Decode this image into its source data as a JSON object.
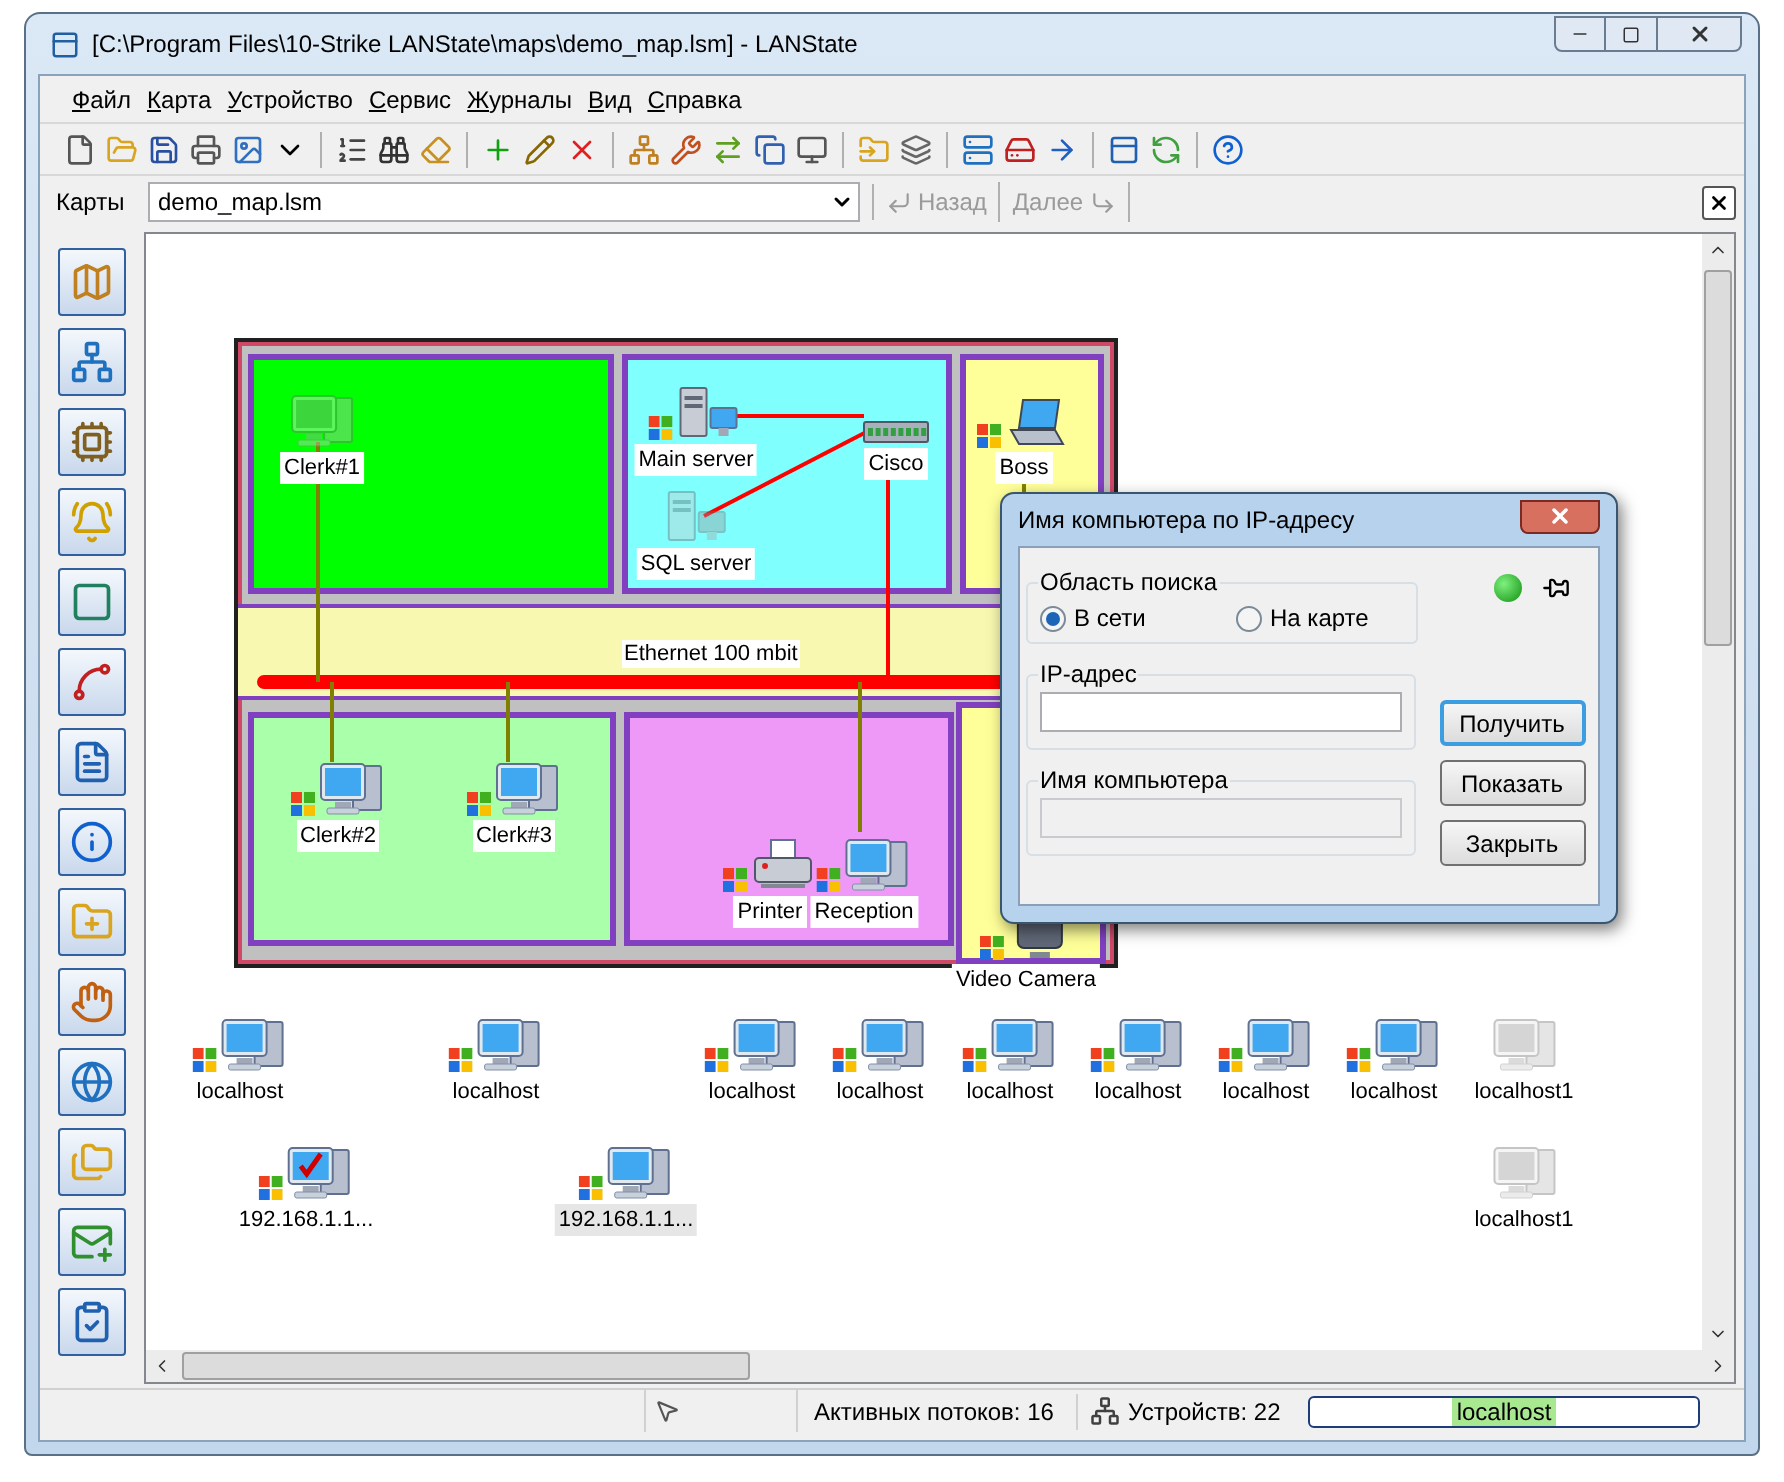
{
  "window": {
    "title": "[C:\\Program Files\\10-Strike LANState\\maps\\demo_map.lsm] - LANState"
  },
  "menu": [
    "Файл",
    "Карта",
    "Устройство",
    "Сервис",
    "Журналы",
    "Вид",
    "Справка"
  ],
  "map_bar": {
    "label": "Карты",
    "value": "demo_map.lsm",
    "back": {
      "label": "Назад",
      "disabled": true
    },
    "forward": {
      "label": "Далее",
      "disabled": true
    }
  },
  "map": {
    "rooms": [
      {
        "color": "#00ff00"
      },
      {
        "color": "#80ffff"
      },
      {
        "color": "#ffff99"
      },
      {
        "color": "#aaffaa"
      },
      {
        "color": "#ee99f8"
      },
      {
        "color": "#ffff99"
      }
    ],
    "segment": {
      "label": "Ethernet 100 mbit"
    },
    "devices": [
      {
        "name": "Clerk#1",
        "kind": "computer",
        "flag": false,
        "offline": true,
        "checked": false,
        "selected": false
      },
      {
        "name": "Main server",
        "kind": "server",
        "flag": true,
        "offline": false,
        "checked": false,
        "selected": false
      },
      {
        "name": "Cisco",
        "kind": "switch",
        "flag": false,
        "offline": false,
        "checked": false,
        "selected": false
      },
      {
        "name": "SQL server",
        "kind": "server",
        "flag": false,
        "offline": true,
        "checked": false,
        "selected": false
      },
      {
        "name": "Boss",
        "kind": "laptop",
        "flag": true,
        "offline": false,
        "checked": false,
        "selected": false
      },
      {
        "name": "Clerk#2",
        "kind": "computer",
        "flag": true,
        "offline": false,
        "checked": false,
        "selected": false
      },
      {
        "name": "Clerk#3",
        "kind": "computer",
        "flag": true,
        "offline": false,
        "checked": false,
        "selected": false
      },
      {
        "name": "Printer",
        "kind": "printer",
        "flag": true,
        "offline": false,
        "checked": false,
        "selected": false
      },
      {
        "name": "Reception",
        "kind": "computer",
        "flag": true,
        "offline": false,
        "checked": false,
        "selected": false
      },
      {
        "name": "Video Camera",
        "kind": "camera",
        "flag": true,
        "offline": false,
        "checked": false,
        "selected": false
      },
      {
        "name": "localhost",
        "kind": "computer",
        "flag": true,
        "offline": false,
        "checked": false,
        "selected": false
      },
      {
        "name": "localhost",
        "kind": "computer",
        "flag": true,
        "offline": false,
        "checked": false,
        "selected": false
      },
      {
        "name": "localhost",
        "kind": "computer",
        "flag": true,
        "offline": false,
        "checked": false,
        "selected": false
      },
      {
        "name": "localhost",
        "kind": "computer",
        "flag": true,
        "offline": false,
        "checked": false,
        "selected": false
      },
      {
        "name": "localhost",
        "kind": "computer",
        "flag": true,
        "offline": false,
        "checked": false,
        "selected": false
      },
      {
        "name": "localhost",
        "kind": "computer",
        "flag": true,
        "offline": false,
        "checked": false,
        "selected": false
      },
      {
        "name": "localhost",
        "kind": "computer",
        "flag": true,
        "offline": false,
        "checked": false,
        "selected": false
      },
      {
        "name": "localhost",
        "kind": "computer",
        "flag": true,
        "offline": false,
        "checked": false,
        "selected": false
      },
      {
        "name": "localhost1",
        "kind": "computer",
        "flag": false,
        "offline": true,
        "checked": false,
        "selected": false
      },
      {
        "name": "192.168.1.1...",
        "kind": "computer",
        "flag": true,
        "offline": false,
        "checked": true,
        "selected": false
      },
      {
        "name": "192.168.1.1...",
        "kind": "computer",
        "flag": true,
        "offline": false,
        "checked": false,
        "selected": true
      },
      {
        "name": "localhost1",
        "kind": "computer",
        "flag": false,
        "offline": true,
        "checked": false,
        "selected": false
      }
    ]
  },
  "dialog": {
    "title": "Имя компьютера по IP-адресу",
    "scope": {
      "label": "Область поиска",
      "options": [
        {
          "label": "В сети",
          "selected": true
        },
        {
          "label": "На карте",
          "selected": false
        }
      ]
    },
    "ip": {
      "label": "IP-адрес"
    },
    "name": {
      "label": "Имя компьютера",
      "disabled": true
    },
    "buttons": [
      {
        "label": "Получить",
        "default": true
      },
      {
        "label": "Показать",
        "default": false
      },
      {
        "label": "Закрыть",
        "default": false
      }
    ]
  },
  "status_bar": {
    "threads": "Активных потоков: 16",
    "devices": "Устройств: 22",
    "host": "localhost"
  }
}
